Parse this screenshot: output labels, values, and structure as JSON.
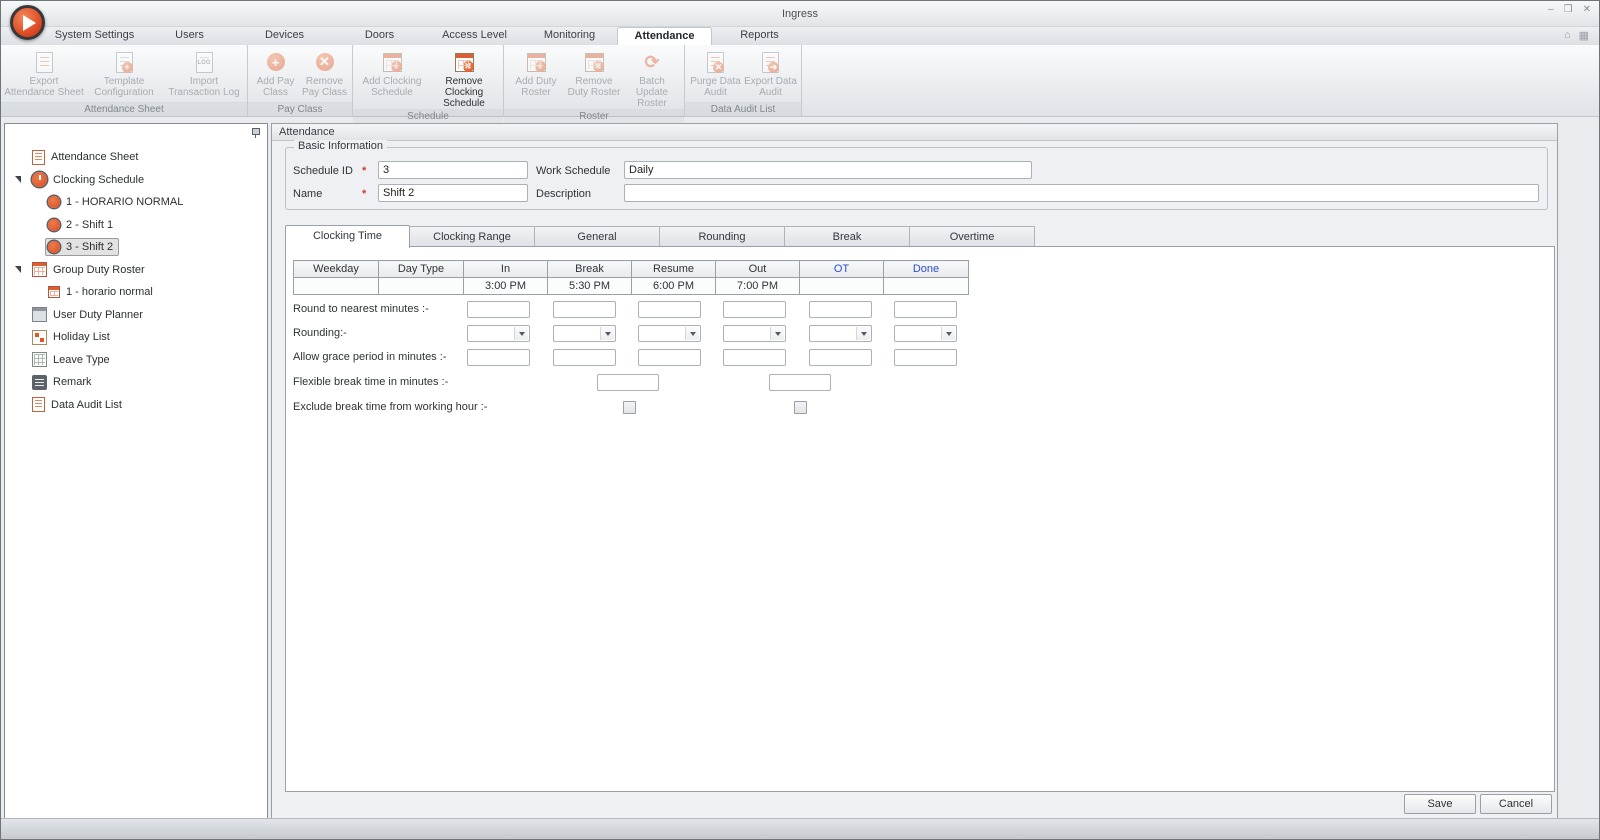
{
  "window": {
    "title": "Ingress",
    "minimize": "–",
    "maximize": "❐",
    "close": "✕"
  },
  "nav_tabs": {
    "items": [
      {
        "label": "System Settings"
      },
      {
        "label": "Users"
      },
      {
        "label": "Devices"
      },
      {
        "label": "Doors"
      },
      {
        "label": "Access Level"
      },
      {
        "label": "Monitoring"
      },
      {
        "label": "Attendance"
      },
      {
        "label": "Reports"
      }
    ],
    "active": "Attendance"
  },
  "ribbon": {
    "groups": [
      {
        "label": "Attendance Sheet",
        "buttons": [
          {
            "label": "Export Attendance Sheet"
          },
          {
            "label": "Template Configuration"
          },
          {
            "label": "Import Transaction Log",
            "icon_text": "LOG"
          }
        ]
      },
      {
        "label": "Pay Class",
        "buttons": [
          {
            "label": "Add Pay Class"
          },
          {
            "label": "Remove Pay Class"
          }
        ]
      },
      {
        "label": "Schedule",
        "buttons": [
          {
            "label": "Add Clocking Schedule"
          },
          {
            "label": "Remove Clocking Schedule"
          }
        ]
      },
      {
        "label": "Roster",
        "buttons": [
          {
            "label": "Add Duty Roster"
          },
          {
            "label": "Remove Duty Roster"
          },
          {
            "label": "Batch Update Roster"
          }
        ]
      },
      {
        "label": "Data Audit List",
        "buttons": [
          {
            "label": "Purge Data Audit"
          },
          {
            "label": "Export Data Audit"
          }
        ]
      }
    ]
  },
  "tree": {
    "items": [
      {
        "label": "Attendance Sheet"
      },
      {
        "label": "Clocking Schedule"
      },
      {
        "label": "1 - HORARIO NORMAL"
      },
      {
        "label": "2 - Shift 1"
      },
      {
        "label": "3 - Shift 2"
      },
      {
        "label": "Group Duty Roster"
      },
      {
        "label": "1 - horario normal"
      },
      {
        "label": "User Duty Planner"
      },
      {
        "label": "Holiday List"
      },
      {
        "label": "Leave Type"
      },
      {
        "label": "Remark"
      },
      {
        "label": "Data Audit List"
      }
    ],
    "selected": "3 - Shift 2"
  },
  "panel": {
    "title": "Attendance",
    "basic_info": {
      "legend": "Basic Information",
      "required_marker": "*",
      "schedule_id_label": "Schedule ID",
      "schedule_id_value": "3",
      "work_schedule_label": "Work Schedule",
      "work_schedule_value": "Daily",
      "name_label": "Name",
      "name_value": "Shift 2",
      "description_label": "Description",
      "description_value": ""
    },
    "detail_tabs": {
      "items": [
        {
          "label": "Clocking Time"
        },
        {
          "label": "Clocking Range"
        },
        {
          "label": "General"
        },
        {
          "label": "Rounding"
        },
        {
          "label": "Break"
        },
        {
          "label": "Overtime"
        }
      ],
      "active": "Clocking Time"
    },
    "clocking_table": {
      "headers": [
        "Weekday",
        "Day Type",
        "In",
        "Break",
        "Resume",
        "Out",
        "OT",
        "Done"
      ],
      "times": {
        "in": "3:00 PM",
        "break": "5:30 PM",
        "resume": "6:00 PM",
        "out": "7:00 PM",
        "ot": "",
        "done": ""
      }
    },
    "form": {
      "round_label": "Round to nearest minutes :-",
      "rounding_label": "Rounding:-",
      "grace_label": "Allow grace period in minutes :-",
      "flexible_label": "Flexible break time in minutes :-",
      "exclude_label": "Exclude break time from working hour :-"
    },
    "save_label": "Save",
    "cancel_label": "Cancel"
  },
  "colors": {
    "accent_orange": "#d94f24",
    "header_blue": "#2a4fd0"
  }
}
